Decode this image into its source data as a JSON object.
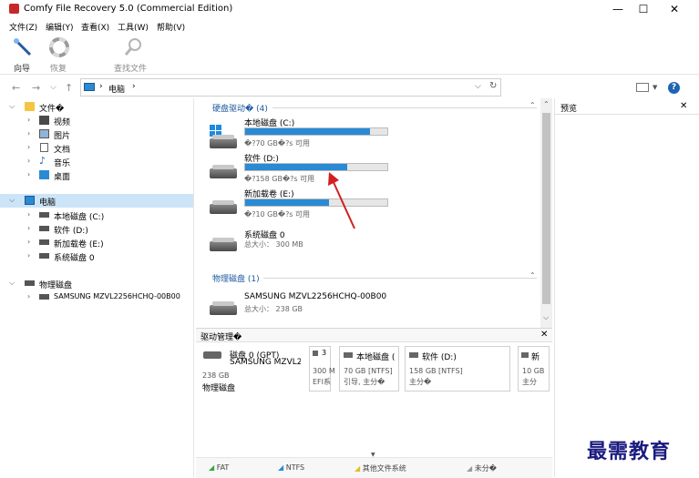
{
  "window": {
    "title": "Comfy File Recovery 5.0 (Commercial Edition)",
    "minimize": "—",
    "maximize": "☐",
    "close": "✕"
  },
  "menu": [
    "文件(Z)",
    "编辑(Y)",
    "查看(X)",
    "工具(W)",
    "帮助(V)"
  ],
  "toolbar": {
    "wizard": "向导",
    "restore": "恢复",
    "find": "查找文件"
  },
  "address": {
    "path": "电脑",
    "sep1": "›",
    "sep2": "›",
    "dropdown": "⌵",
    "refresh": "↻"
  },
  "nav": {
    "back": "←",
    "forward": "→",
    "down": "⌵",
    "up": "↑"
  },
  "tree": {
    "files_root": "文件�",
    "videos": "视频",
    "pictures": "图片",
    "documents": "文档",
    "music": "音乐",
    "desktop": "桌面",
    "computer": "电脑",
    "local": "本地磁盘 (C:)",
    "software": "软件 (D:)",
    "newvol": "新加载卷 (E:)",
    "sysdisk": "系统磁盘 0",
    "physical": "物理磁盘",
    "samsung": "SAMSUNG MZVL2256HCHQ-00B00"
  },
  "center": {
    "group_drives": "硬盘驱动� (4)",
    "group_physical": "物理磁盘 (1)",
    "drives": [
      {
        "name": "本地磁盘 (C:)",
        "sub": "�?70 GB�?s 可用",
        "used": 0.88
      },
      {
        "name": "软件 (D:)",
        "sub": "�?158 GB�?s 可用",
        "used": 0.72
      },
      {
        "name": "新加载卷 (E:)",
        "sub": "�?10 GB�?s 可用",
        "used": 0.59
      }
    ],
    "sysdisk": {
      "name": "系统磁盘 0",
      "sub": "总大小： 300 MB"
    },
    "physical_disk": {
      "name": "SAMSUNG MZVL2256HCHQ-00B00",
      "sub": "总大小： 238 GB"
    }
  },
  "preview": {
    "title": "预览",
    "close": "✕"
  },
  "drivemgr": {
    "title": "驱动管理�",
    "close": "✕",
    "disk_title": "磁盘 0 (GPT)",
    "disk_model": "SAMSUNG MZVL2256",
    "disk_size": "238 GB",
    "disk_type": "物理磁盘",
    "efi": {
      "title": "3",
      "l1": "300 M",
      "l2": "EFI系"
    },
    "c": {
      "title": "本地磁盘 (",
      "l1": "70 GB [NTFS]",
      "l2": "引导, 主分�"
    },
    "d": {
      "title": "软件 (D:)",
      "l1": "158 GB [NTFS]",
      "l2": "主分�"
    },
    "e": {
      "title": "新",
      "l1": "10 GB",
      "l2": "主分"
    },
    "legend": {
      "fat": "FAT",
      "ntfs": "NTFS",
      "other": "其他文件系统",
      "unalloc": "未分�"
    }
  },
  "watermark": "最需教育",
  "colors": {
    "accent": "#2a8ad4",
    "selection": "#cce4f7",
    "link": "#1e5aa0",
    "arrow": "#d21f1f"
  }
}
